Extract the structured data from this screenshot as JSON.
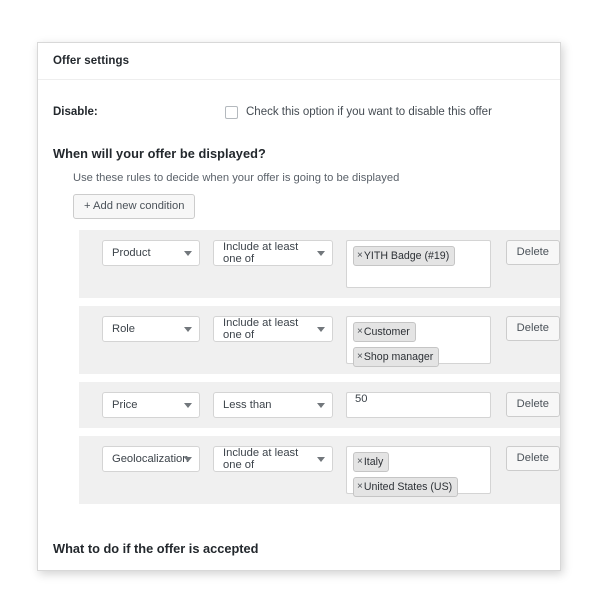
{
  "panel": {
    "header_title": "Offer settings"
  },
  "disable": {
    "label": "Disable:",
    "checkbox_text": "Check this option if you want to disable this offer",
    "checked": false
  },
  "display_section": {
    "heading": "When will your offer be displayed?",
    "description": "Use these rules to decide when your offer is going to be displayed",
    "add_condition_label": "+ Add new condition",
    "delete_label": "Delete",
    "rules": [
      {
        "type": "Product",
        "condition": "Include at least one of",
        "value_kind": "tokens",
        "tokens": [
          "YITH Badge (#19)"
        ]
      },
      {
        "type": "Role",
        "condition": "Include at least one of",
        "value_kind": "tokens",
        "tokens": [
          "Customer",
          "Shop manager"
        ]
      },
      {
        "type": "Price",
        "condition": "Less than",
        "value_kind": "text",
        "text_value": "50"
      },
      {
        "type": "Geolocalization",
        "condition": "Include at least one of",
        "value_kind": "tokens",
        "tokens": [
          "Italy",
          "United States (US)"
        ]
      }
    ]
  },
  "accepted_section": {
    "heading": "What to do if the offer is accepted"
  },
  "icons": {
    "token_remove": "×",
    "select_caret": "chevron-down-icon"
  },
  "colors": {
    "panel_border": "#d8d8d8",
    "rule_bg": "#f0f0f0",
    "token_bg": "#e4e4e4",
    "text": "#23282d"
  }
}
